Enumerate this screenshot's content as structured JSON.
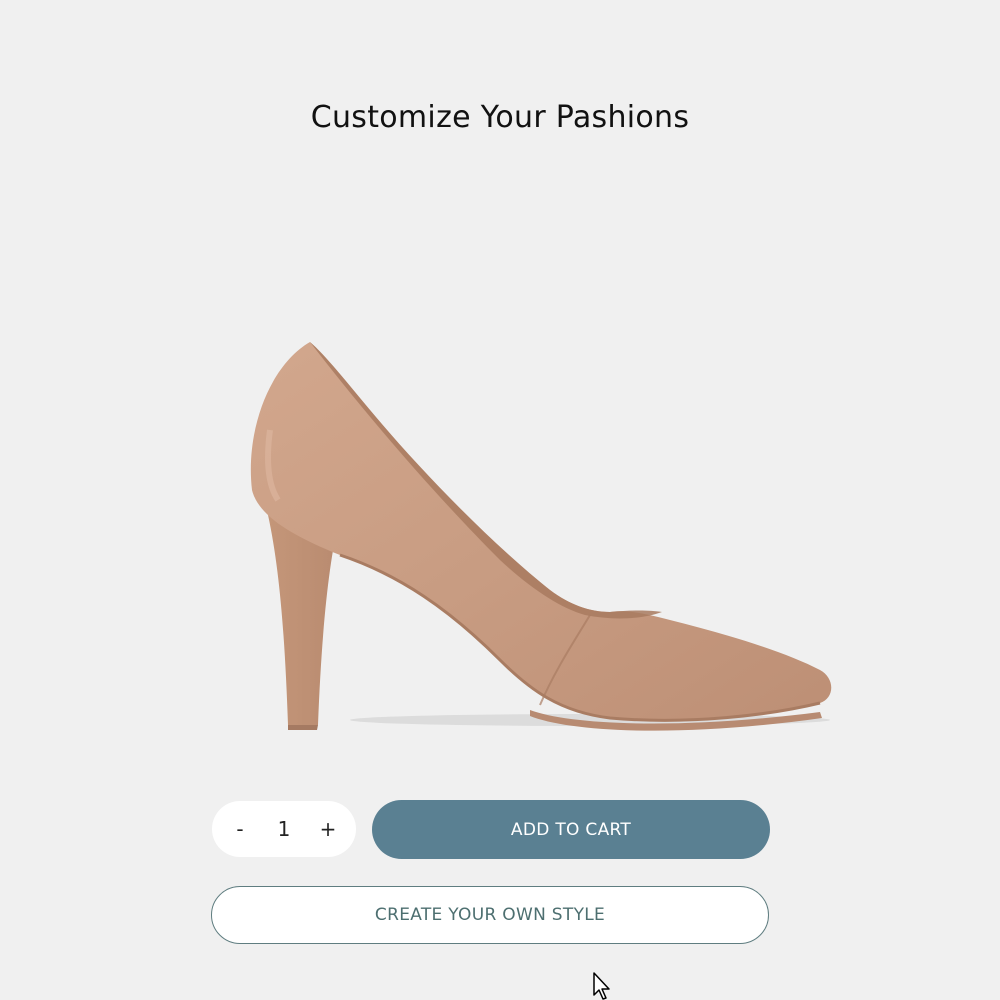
{
  "header": {
    "title": "Customize Your Pashions"
  },
  "product": {
    "image_icon": "high-heel-pump-shoe",
    "color": "#c99e84"
  },
  "cart": {
    "decrement_label": "-",
    "quantity": "1",
    "increment_label": "+",
    "add_to_cart_label": "ADD TO CART",
    "create_style_label": "CREATE YOUR OWN STYLE"
  },
  "colors": {
    "background": "#f0f0f0",
    "accent": "#5a8092",
    "outline": "#5f7d80"
  },
  "cursor": {
    "icon": "mouse-pointer-icon"
  }
}
